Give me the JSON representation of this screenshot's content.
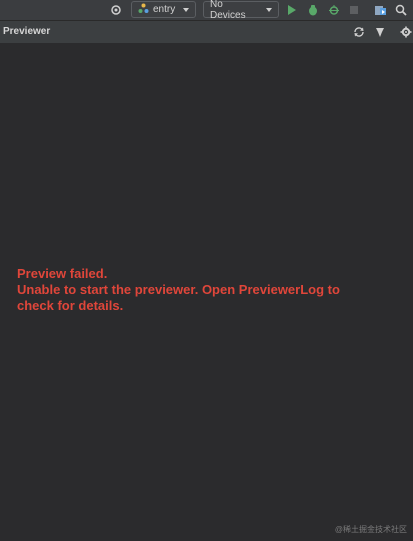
{
  "toolbar": {
    "module_select": "entry",
    "device_select": "No Devices"
  },
  "panel": {
    "title": "Previewer"
  },
  "error": {
    "line1": "Preview failed.",
    "line2": "Unable to start the previewer. Open PreviewerLog to",
    "line3": "check for details."
  },
  "watermark": "@稀土掘金技术社区",
  "colors": {
    "background": "#2b2b2d",
    "toolbar": "#3b3d40",
    "error_text": "#e0463a",
    "run_green": "#59a869"
  },
  "icons": [
    "target-icon",
    "module-icon",
    "run-icon",
    "debug-icon",
    "bug-icon",
    "stop-icon",
    "device-manager-icon",
    "search-icon",
    "refresh-icon",
    "pin-icon",
    "gear-icon"
  ]
}
